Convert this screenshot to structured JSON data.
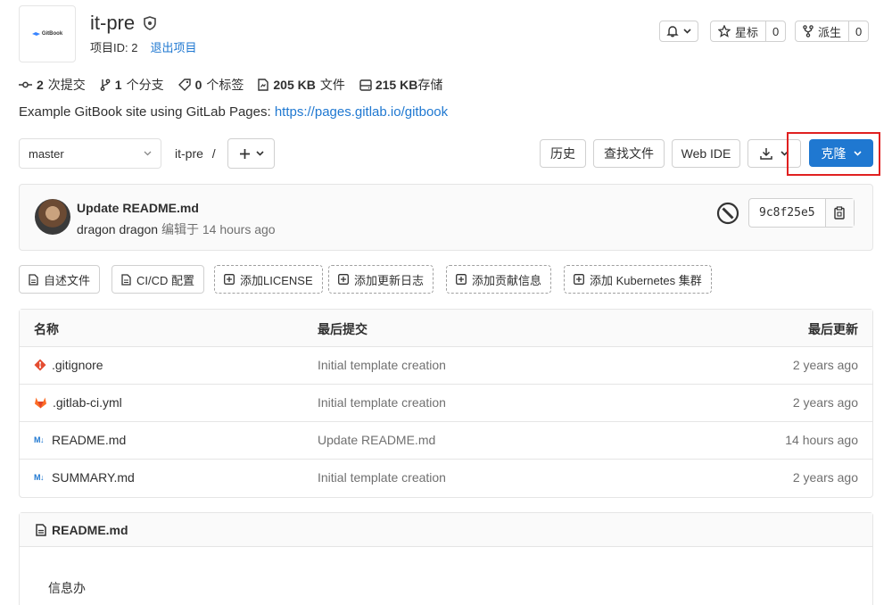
{
  "project": {
    "logo_text": "GitBook",
    "name": "it-pre",
    "id_label": "项目ID: 2",
    "leave_label": "退出项目",
    "star_label": "星标",
    "star_count": "0",
    "fork_label": "派生",
    "fork_count": "0"
  },
  "stats": {
    "commits_num": "2",
    "commits_label": "次提交",
    "branches_num": "1",
    "branches_label": "个分支",
    "tags_num": "0",
    "tags_label": "个标签",
    "files_num": "205 KB",
    "files_label": "文件",
    "storage_num": "215 KB",
    "storage_label": "存储"
  },
  "description": {
    "text": "Example GitBook site using GitLab Pages: ",
    "link": "https://pages.gitlab.io/gitbook"
  },
  "toolbar": {
    "branch": "master",
    "path": "it-pre",
    "path_sep": "/",
    "history": "历史",
    "find_file": "查找文件",
    "web_ide": "Web IDE",
    "clone": "克隆"
  },
  "commit": {
    "title": "Update README.md",
    "author": "dragon dragon",
    "action": "编辑于",
    "time": "14 hours ago",
    "sha": "9c8f25e5"
  },
  "shortcuts": {
    "readme": "自述文件",
    "cicd": "CI/CD 配置",
    "license": "添加LICENSE",
    "changelog": "添加更新日志",
    "contributing": "添加贡献信息",
    "kubernetes": "添加 Kubernetes 集群"
  },
  "table": {
    "headers": {
      "name": "名称",
      "commit": "最后提交",
      "updated": "最后更新"
    },
    "rows": [
      {
        "name": ".gitignore",
        "commit": "Initial template creation",
        "updated": "2 years ago",
        "icon": "git-icon"
      },
      {
        "name": ".gitlab-ci.yml",
        "commit": "Initial template creation",
        "updated": "2 years ago",
        "icon": "gitlab-icon"
      },
      {
        "name": "README.md",
        "commit": "Update README.md",
        "updated": "14 hours ago",
        "icon": "markdown-icon"
      },
      {
        "name": "SUMMARY.md",
        "commit": "Initial template creation",
        "updated": "2 years ago",
        "icon": "markdown-icon"
      }
    ],
    "md_icon_text": "M↓"
  },
  "readme": {
    "title": "README.md",
    "content": "信息办"
  },
  "colors": {
    "primary": "#1f78d1",
    "highlight_border": "#e02020"
  }
}
